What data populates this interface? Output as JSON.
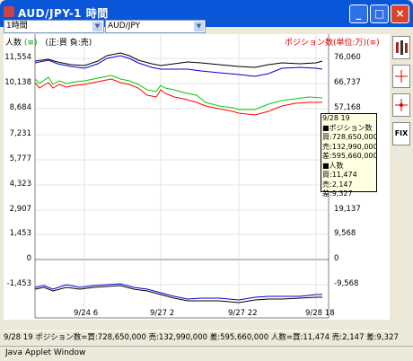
{
  "window": {
    "title": "AUD/JPY-1 時間"
  },
  "controls": {
    "period": "1時間",
    "pair": "AUD/JPY"
  },
  "legend": {
    "left_label": "人数",
    "green_symbol": "(≡)",
    "sign_note": "(正:買 負:売)",
    "right_label": "ポジション数(単位:万)",
    "red_symbol": "(≡)"
  },
  "side_buttons": [
    "bars-icon",
    "crosshair-icon",
    "crosshair-red-icon",
    "fix-icon"
  ],
  "side_labels": {
    "fix": "FIX"
  },
  "left_axis": [
    "11,554",
    "10,138",
    "8,684",
    "7,231",
    "5,777",
    "4,323",
    "2,907",
    "1,453",
    "0",
    "-1,453"
  ],
  "right_axis": [
    "76,060",
    "66,737",
    "57,168",
    "47,837",
    "38,306",
    "28,706",
    "19,137",
    "9,568",
    "0",
    "-9,568"
  ],
  "x_axis": [
    "9/24 6",
    "9/27 2",
    "9/27 22",
    "9/28 18"
  ],
  "tooltip": [
    "9/28 19",
    "■ポジション数",
    "買:728,650,000",
    "売:132,990,000",
    "差:595,660,000",
    "■人数",
    "買:11,474",
    "売:2,147",
    "差:9,327"
  ],
  "status": "9/28 19  ポジション数=買:728,650,000 売:132,990,000 差:595,660,000 人数=買:11,474 売:2,147 差:9,327",
  "footer": "Java Applet Window",
  "colors": {
    "titlebar": "#0a56d8",
    "green": "#00cc00",
    "red": "#ff0000",
    "blue": "#0000cc",
    "black": "#000000"
  }
}
